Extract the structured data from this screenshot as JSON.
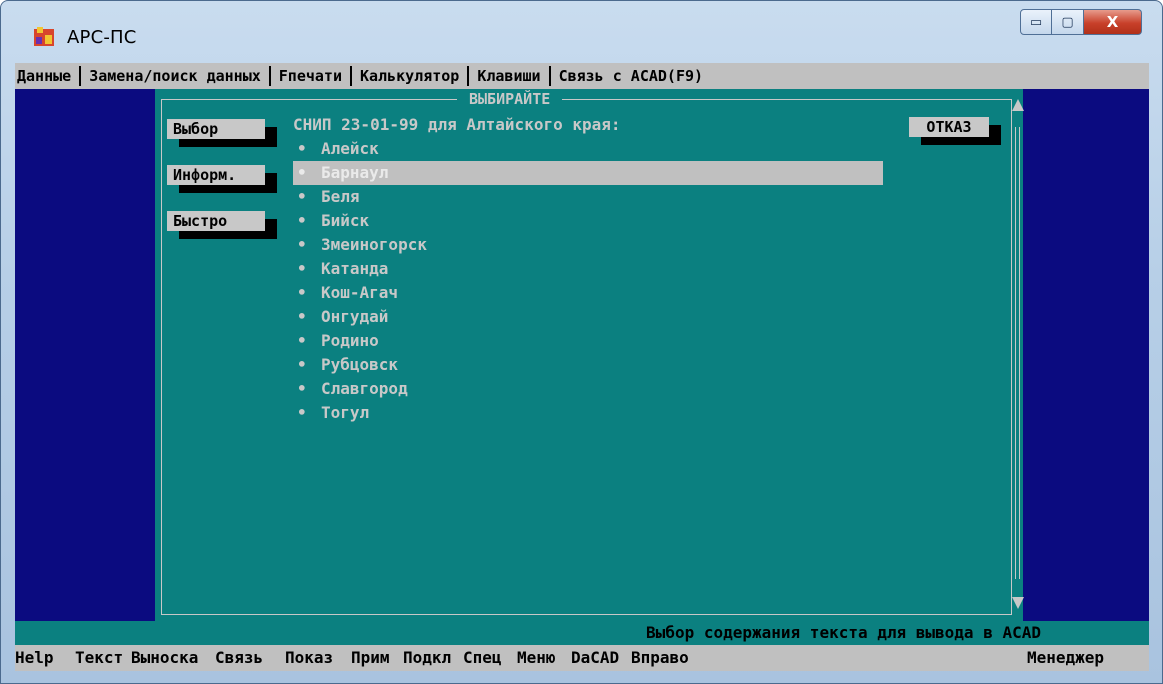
{
  "window": {
    "title": "APC-ПС",
    "controls": {
      "minimize": "▭",
      "maximize": "▢",
      "close": "X"
    }
  },
  "menu": [
    "Данные",
    "Замена/поиск данных",
    "Fпечати",
    "Калькулятор",
    "Клавиши",
    "Связь с ACAD(F9)"
  ],
  "dialog": {
    "frame_title": "ВЫБИРАЙТЕ",
    "buttons": {
      "select": "Выбор",
      "info": "Информ.",
      "quick": "Быстро",
      "cancel": "ОТКАЗ"
    },
    "header": "СНИП 23-01-99 для Алтайского края:",
    "bullet": "•",
    "items": [
      "Алейск",
      "Барнаул",
      "Беля",
      "Бийск",
      "Змеиногорск",
      "Катанда",
      "Кош-Агач",
      "Онгудай",
      "Родино",
      "Рубцовск",
      "Славгород",
      "Тогул"
    ],
    "selected_index": 1
  },
  "status": "Выбор содержания текста для вывода в ACAD",
  "fkeys": [
    "Help",
    "Текст",
    "Выноска",
    "Связь",
    "Показ",
    "Прим",
    "Подкл",
    "Спец",
    "Меню",
    "DaCAD",
    "Вправо",
    "Менеджер"
  ]
}
